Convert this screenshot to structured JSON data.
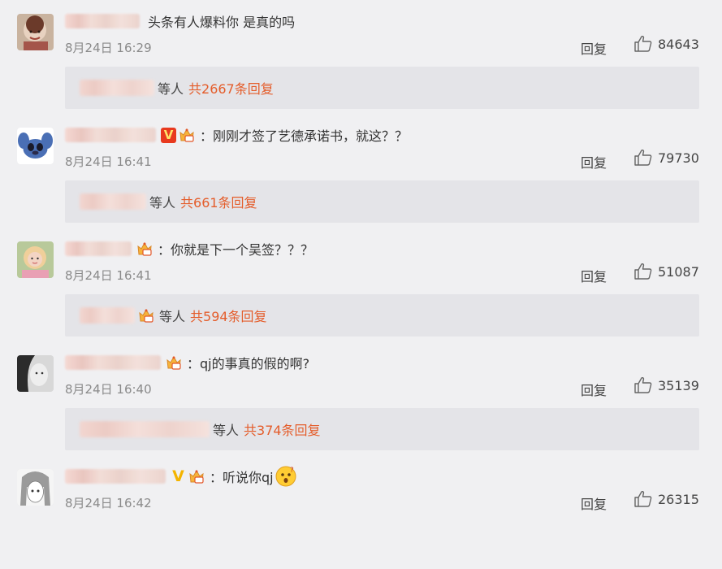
{
  "comments": [
    {
      "text": "头条有人爆料你 是真的吗",
      "time": "8月24日 16:29",
      "reply_label": "回复",
      "likes": "84643",
      "sub": {
        "people_suffix": "等人",
        "count_label": "共2667条回复"
      }
    },
    {
      "text": "：刚刚才签了艺德承诺书，就这？？",
      "time": "8月24日 16:41",
      "reply_label": "回复",
      "likes": "79730",
      "sub": {
        "people_suffix": "等人",
        "count_label": "共661条回复"
      }
    },
    {
      "text": "：你就是下一个吴签？？？",
      "time": "8月24日 16:41",
      "reply_label": "回复",
      "likes": "51087",
      "sub": {
        "people_suffix": "等人",
        "count_label": "共594条回复"
      }
    },
    {
      "text": "：qj的事真的假的啊?",
      "time": "8月24日 16:40",
      "reply_label": "回复",
      "likes": "35139",
      "sub": {
        "people_suffix": "等人",
        "count_label": "共374条回复"
      }
    },
    {
      "text": "：听说你qj",
      "time": "8月24日 16:42",
      "reply_label": "回复",
      "likes": "26315"
    }
  ],
  "badges": {
    "verified_v": "V"
  },
  "colors": {
    "link": "#e45d2b",
    "background": "#f0f0f2",
    "sub_box": "#e4e4e8"
  },
  "icons": {
    "like": "thumbs-up-icon",
    "crown": "vip-crown-icon",
    "emoji": "surprised-emoji-icon"
  }
}
